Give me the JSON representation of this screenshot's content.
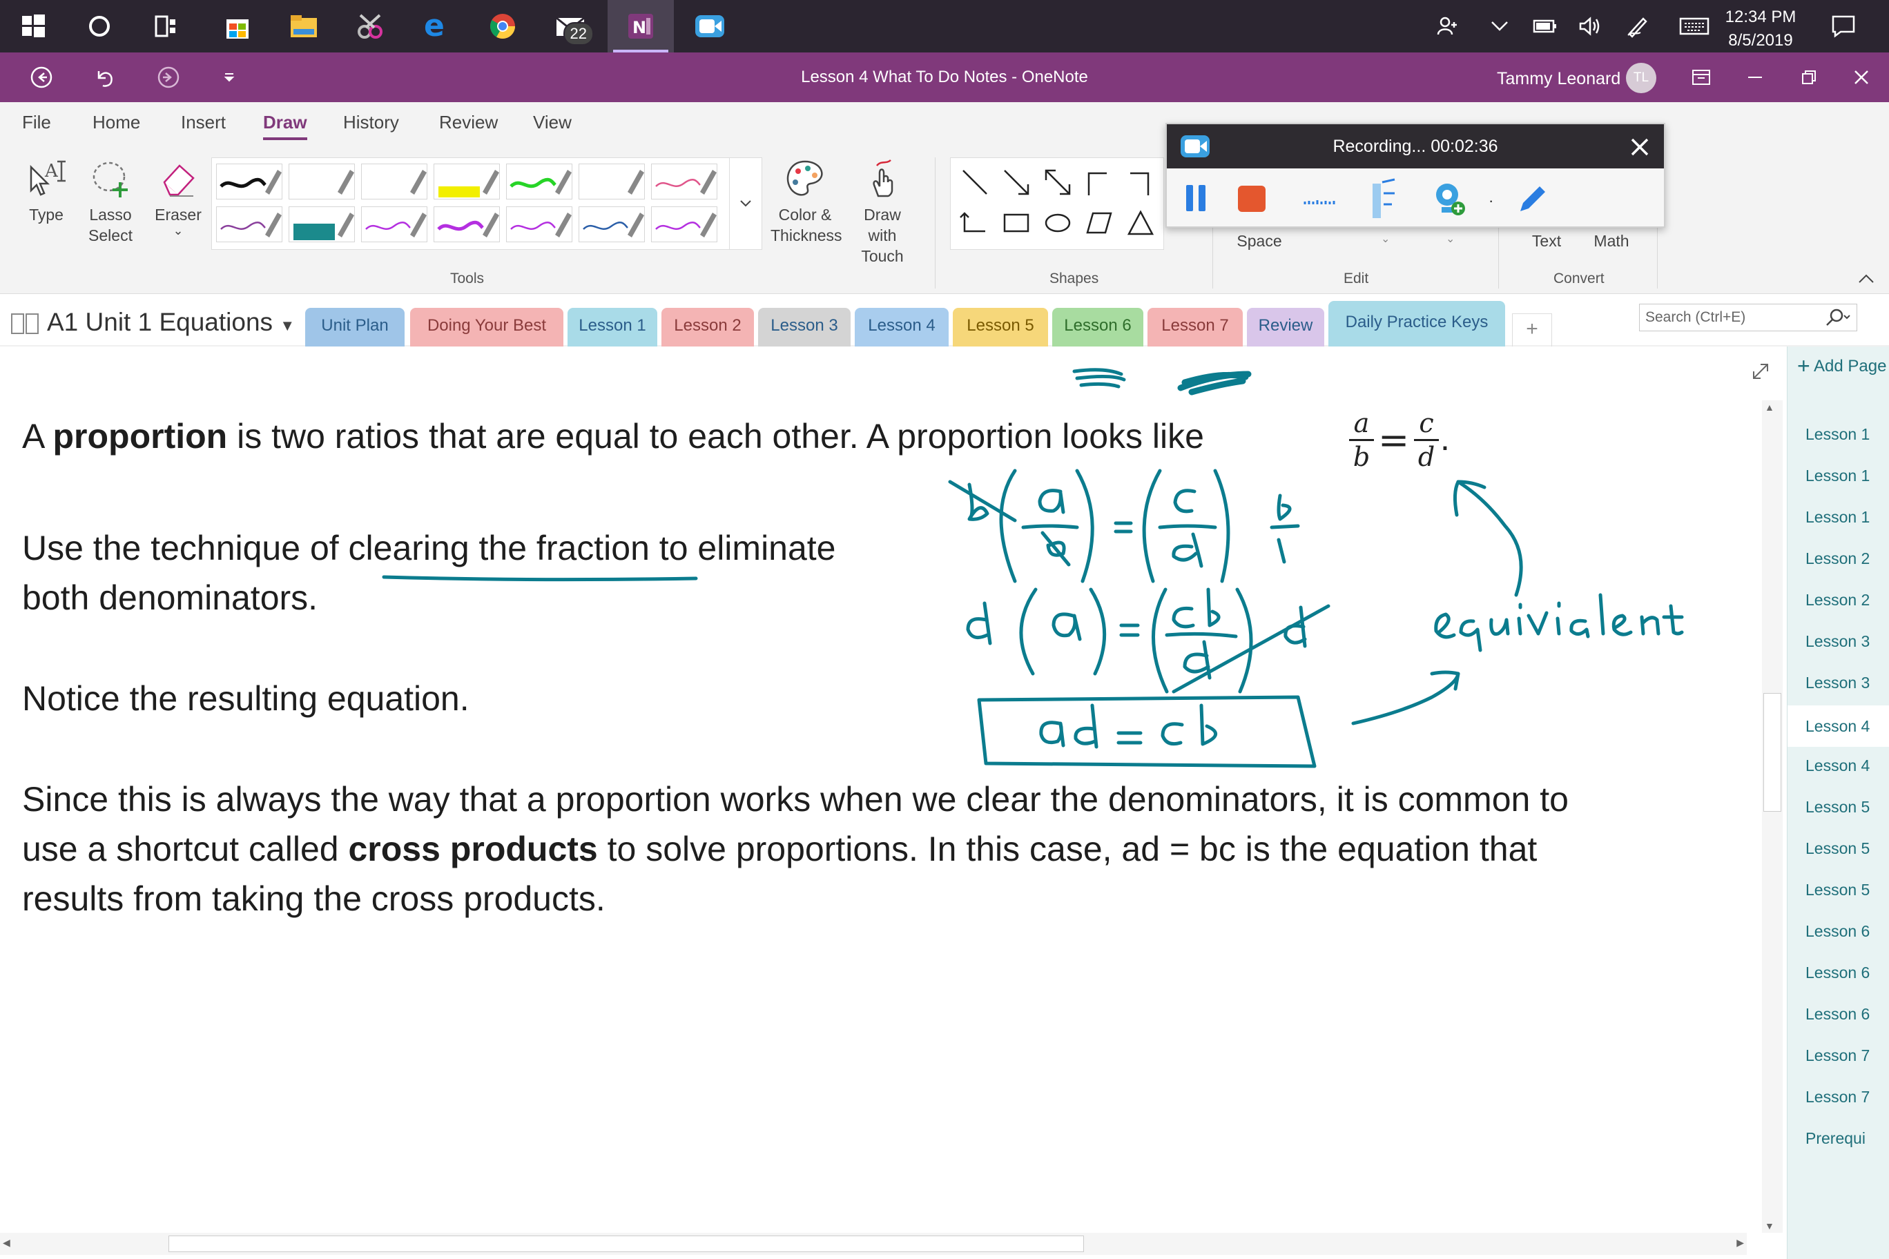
{
  "taskbar": {
    "apps": [
      {
        "icon": "windows-start-icon"
      },
      {
        "icon": "cortana-icon"
      },
      {
        "icon": "task-view-icon"
      },
      {
        "icon": "store-icon"
      },
      {
        "icon": "file-explorer-icon"
      },
      {
        "icon": "snipping-tool-icon"
      },
      {
        "icon": "edge-icon"
      },
      {
        "icon": "chrome-icon"
      },
      {
        "icon": "mail-icon",
        "badge": "22"
      },
      {
        "icon": "onenote-icon"
      },
      {
        "icon": "screen-recorder-icon"
      }
    ],
    "clock_time": "12:34 PM",
    "clock_date": "8/5/2019"
  },
  "titlebar": {
    "title": "Lesson 4 What To Do Notes  -  OneNote",
    "user_name": "Tammy Leonard",
    "user_initials": "TL"
  },
  "menu_tabs": [
    "File",
    "Home",
    "Insert",
    "Draw",
    "History",
    "Review",
    "View"
  ],
  "active_menu_tab": "Draw",
  "ribbon": {
    "type_label": "Type",
    "lasso_label": "Lasso Select",
    "eraser_label": "Eraser",
    "tools_group": "Tools",
    "color_label": "Color & Thickness",
    "touch_label": "Draw with Touch",
    "shapes_group": "Shapes",
    "space_label": "Space",
    "edit_group": "Edit",
    "text_label": "Text",
    "math_label": "Math",
    "convert_group": "Convert",
    "pen_colors": [
      "#111111",
      "#7a7a7a",
      "#7a7a7a",
      "#f2ef00",
      "#27d427",
      "#9a9a9a",
      "#e0558a",
      "#8a3f9c",
      "#1b8a8c",
      "#b42fe0",
      "#b42fe0",
      "#b42fe0",
      "#2a5ea8",
      "#b42fe0"
    ]
  },
  "recording": {
    "status": "Recording... 00:02:36"
  },
  "notebook": {
    "name": "A1 Unit 1 Equations",
    "sections": [
      {
        "label": "Unit Plan",
        "color": "#9fc5e8"
      },
      {
        "label": "Doing Your Best",
        "color": "#f4b4b4"
      },
      {
        "label": "Lesson 1",
        "color": "#a9dbe8"
      },
      {
        "label": "Lesson 2",
        "color": "#f4b4b4"
      },
      {
        "label": "Lesson 3",
        "color": "#d4d4d4"
      },
      {
        "label": "Lesson 4",
        "color": "#a9cdee"
      },
      {
        "label": "Lesson 5",
        "color": "#f6d77a"
      },
      {
        "label": "Lesson 6",
        "color": "#a8dca0"
      },
      {
        "label": "Lesson 7",
        "color": "#f4b4b4"
      },
      {
        "label": "Review",
        "color": "#d9c6ea"
      },
      {
        "label": "Daily Practice Keys",
        "color": "#a9dbe8"
      }
    ],
    "add_section": "+",
    "search_placeholder": "Search (Ctrl+E)"
  },
  "page": {
    "para1_a": "A ",
    "para1_bold": "proportion",
    "para1_b": " is two ratios that are equal to each other.  A proportion looks like ",
    "frac1_num": "a",
    "frac1_den": "b",
    "equals": "=",
    "frac2_num": "c",
    "frac2_den": "d",
    "period": ".",
    "para2_a": "Use the technique of ",
    "para2_underline": "clearing the fraction",
    "para2_b": " to eliminate",
    "para2_line2": "both denominators.",
    "para3": "Notice the resulting equation.",
    "para4_line1": "Since this is always the way that a proportion works when we clear the denominators, it is common to",
    "para4_line2_a": "use a shortcut called ",
    "para4_line2_bold": "cross products",
    "para4_line2_b": " to solve proportions.  In this case, ad = bc is the equation that",
    "para4_line3": "results from taking the cross products.",
    "ink_word": "equivalent",
    "ink_result": "ad = cb",
    "ink_color": "#0b7c8e"
  },
  "pages_panel": {
    "add_page": "Add Page",
    "items": [
      "Lesson 1",
      "Lesson 1",
      "Lesson 1",
      "Lesson 2",
      "Lesson 2",
      "Lesson 3",
      "Lesson 3",
      "Lesson 4",
      "Lesson 4",
      "Lesson 5",
      "Lesson 5",
      "Lesson 5",
      "Lesson 6",
      "Lesson 6",
      "Lesson 6",
      "Lesson 7",
      "Lesson 7",
      "Prerequi"
    ],
    "active_index": 7
  }
}
